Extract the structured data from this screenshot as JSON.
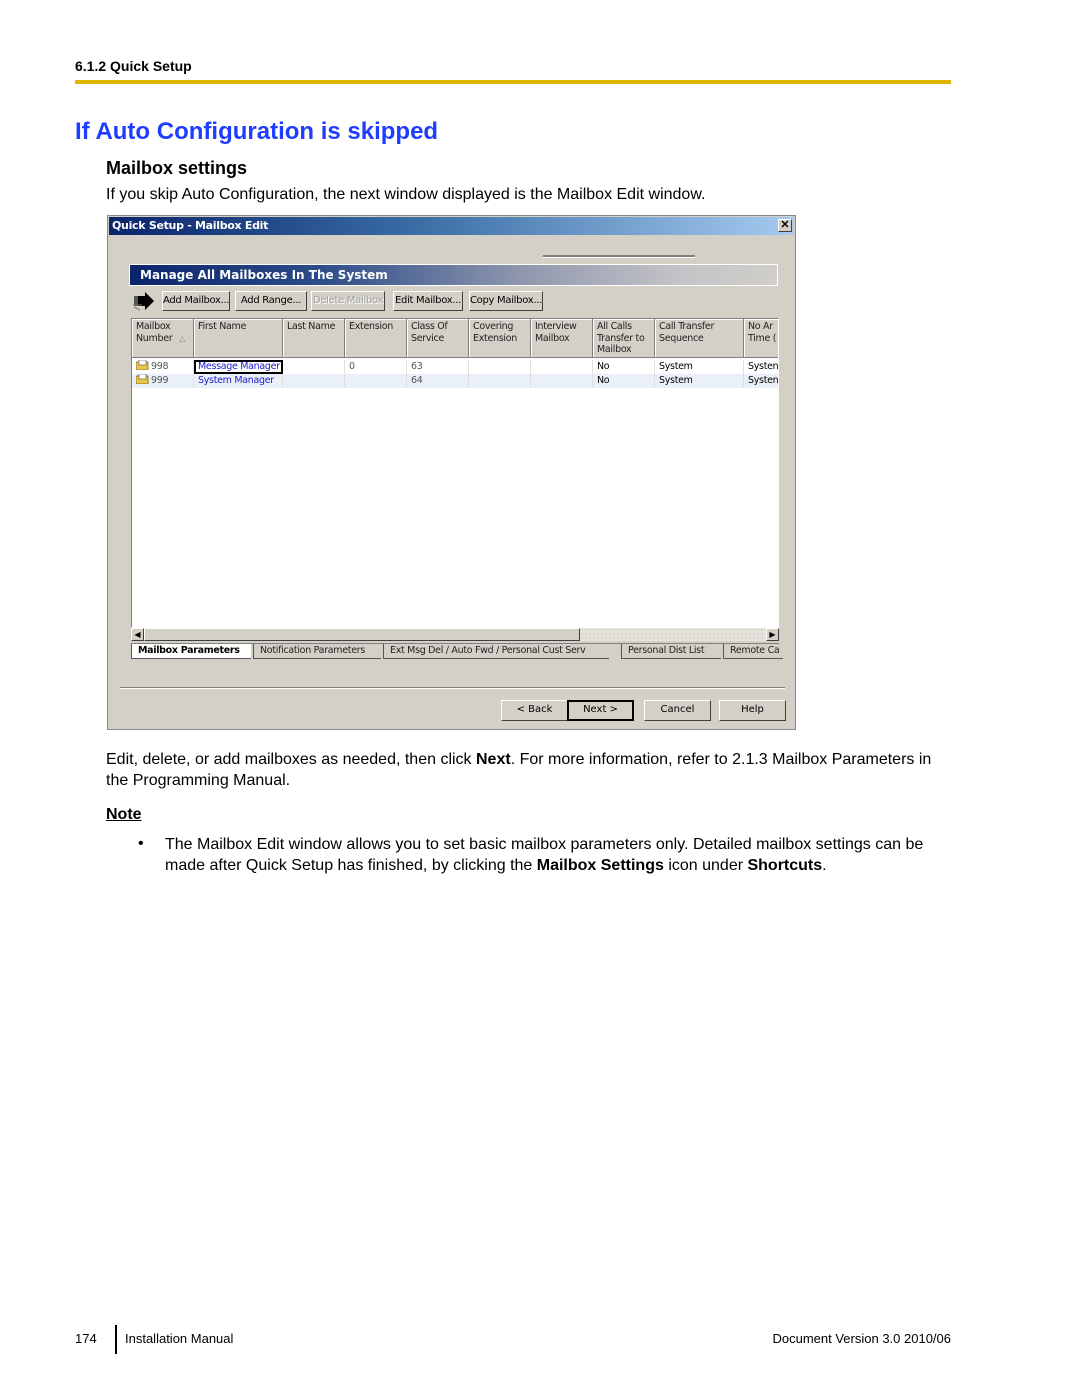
{
  "header": {
    "section": "6.1.2 Quick Setup",
    "rule_color": "#e0b400"
  },
  "page_title": "If Auto Configuration is skipped",
  "title_color": "#1f3dff",
  "subsection": "Mailbox settings",
  "intro": "If you skip Auto Configuration, the next window displayed is the Mailbox Edit window.",
  "dialog": {
    "title": "Quick Setup - Mailbox Edit",
    "close_glyph": "✕",
    "panel_title": "Manage All Mailboxes In The System",
    "toolbar": {
      "arrow_icon": "right-arrow-icon",
      "buttons": [
        {
          "label": "Add Mailbox...",
          "enabled": true
        },
        {
          "label": "Add Range...",
          "enabled": true
        },
        {
          "label": "Delete Mailbox",
          "enabled": false
        },
        {
          "label": "Edit Mailbox...",
          "enabled": true
        },
        {
          "label": "Copy Mailbox...",
          "enabled": true
        }
      ]
    },
    "grid": {
      "columns": [
        {
          "label": "Mailbox\nNumber",
          "sorted": "ascending"
        },
        {
          "label": "First Name"
        },
        {
          "label": "Last Name"
        },
        {
          "label": "Extension"
        },
        {
          "label": "Class Of\nService"
        },
        {
          "label": "Covering\nExtension"
        },
        {
          "label": "Interview\nMailbox"
        },
        {
          "label": "All Calls\nTransfer to\nMailbox"
        },
        {
          "label": "Call Transfer\nSequence"
        },
        {
          "label": "No Ar\nTime ("
        }
      ],
      "sort_glyph": "△",
      "rows": [
        {
          "cells": [
            "998",
            "Message Manager",
            "",
            "0",
            "63",
            "",
            "",
            "No",
            "System",
            "Systen"
          ],
          "focused_cell": 1
        },
        {
          "cells": [
            "999",
            "System Manager",
            "",
            "",
            "64",
            "",
            "",
            "No",
            "System",
            "Systen"
          ]
        }
      ],
      "row_icon": "mailbox-folder-icon"
    },
    "scroll": {
      "left_glyph": "◀",
      "right_glyph": "▶"
    },
    "tabs": [
      {
        "label": "Mailbox Parameters",
        "active": true
      },
      {
        "label": "Notification Parameters",
        "active": false
      },
      {
        "label": "Ext Msg Del / Auto Fwd / Personal Cust Serv",
        "active": false
      },
      {
        "label": "Personal Dist List",
        "active": false
      },
      {
        "label": "Remote Ca",
        "active": false
      }
    ],
    "buttons": {
      "back": "< Back",
      "next": "Next >",
      "cancel": "Cancel",
      "help": "Help"
    }
  },
  "para1": {
    "pre": "Edit, delete, or add mailboxes as needed, then click ",
    "bold": "Next",
    "post": ". For more information, refer to 2.1.3  Mailbox Parameters in the Programming Manual."
  },
  "note": {
    "title": "Note",
    "bullet": "•",
    "pre": "The Mailbox Edit window allows you to set basic mailbox parameters only. Detailed mailbox settings can be made after Quick Setup has finished, by clicking the ",
    "bold1": "Mailbox Settings",
    "mid": " icon under ",
    "bold2": "Shortcuts",
    "post": "."
  },
  "footer": {
    "page_number": "174",
    "left": "Installation Manual",
    "right": "Document Version  3.0  2010/06"
  }
}
